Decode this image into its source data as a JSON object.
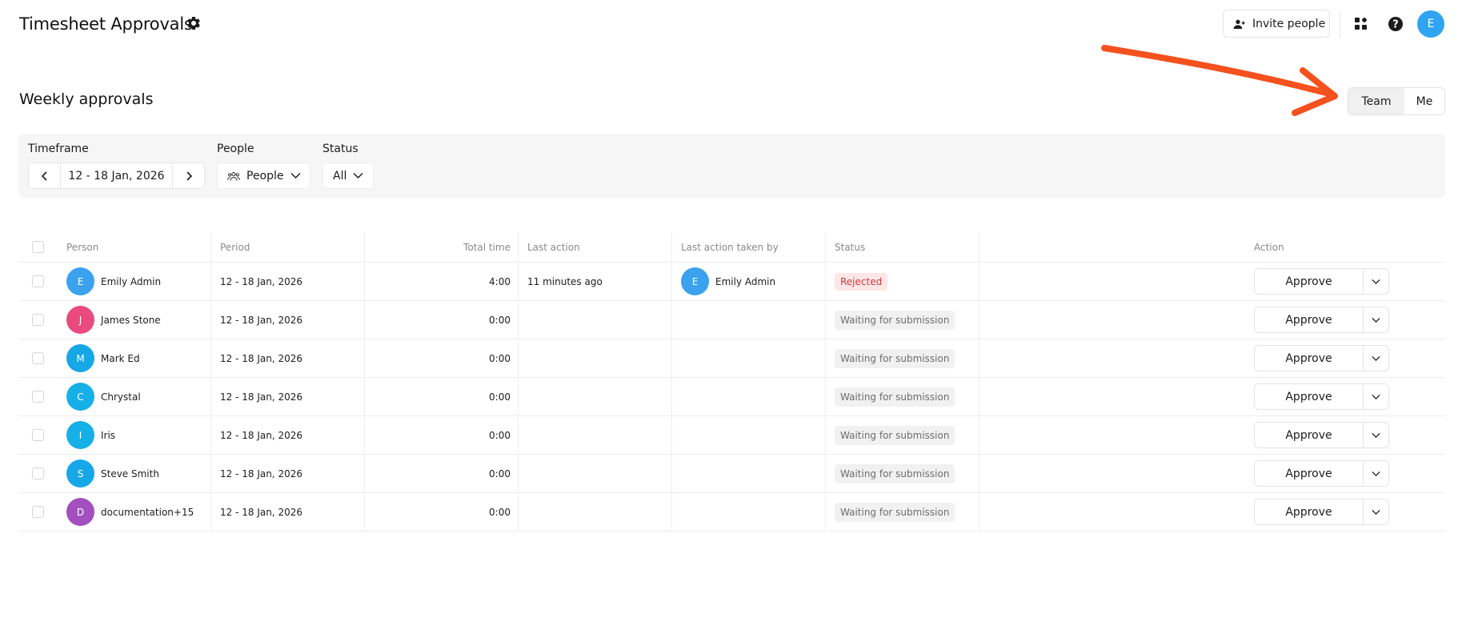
{
  "header": {
    "title": "Timesheet Approvals",
    "invite_label": "Invite people",
    "user_initial": "E"
  },
  "section": {
    "title": "Weekly approvals",
    "toggle": {
      "team_label": "Team",
      "me_label": "Me",
      "selected": "Team"
    }
  },
  "filters": {
    "timeframe_label": "Timeframe",
    "timeframe_value": "12 - 18 Jan, 2026",
    "people_label": "People",
    "people_value": "People",
    "status_label": "Status",
    "status_value": "All"
  },
  "table": {
    "columns": {
      "person": "Person",
      "period": "Period",
      "total_time": "Total time",
      "last_action": "Last action",
      "last_action_by": "Last action taken by",
      "status": "Status",
      "action": "Action"
    },
    "approve_label": "Approve",
    "rows": [
      {
        "initial": "E",
        "avatar_color": "#3aa2ee",
        "name": "Emily Admin",
        "period": "12 - 18 Jan, 2026",
        "total": "4:00",
        "last_action": "11 minutes ago",
        "by_initial": "E",
        "by_name": "Emily Admin",
        "status": "Rejected",
        "status_type": "rejected"
      },
      {
        "initial": "J",
        "avatar_color": "#ea4a7d",
        "name": "James Stone",
        "period": "12 - 18 Jan, 2026",
        "total": "0:00",
        "last_action": "",
        "by_initial": "",
        "by_name": "",
        "status": "Waiting for submission",
        "status_type": "waiting"
      },
      {
        "initial": "M",
        "avatar_color": "#15a7e6",
        "name": "Mark Ed",
        "period": "12 - 18 Jan, 2026",
        "total": "0:00",
        "last_action": "",
        "by_initial": "",
        "by_name": "",
        "status": "Waiting for submission",
        "status_type": "waiting"
      },
      {
        "initial": "C",
        "avatar_color": "#15b0e8",
        "name": "Chrystal",
        "period": "12 - 18 Jan, 2026",
        "total": "0:00",
        "last_action": "",
        "by_initial": "",
        "by_name": "",
        "status": "Waiting for submission",
        "status_type": "waiting"
      },
      {
        "initial": "I",
        "avatar_color": "#15b0e8",
        "name": "Iris",
        "period": "12 - 18 Jan, 2026",
        "total": "0:00",
        "last_action": "",
        "by_initial": "",
        "by_name": "",
        "status": "Waiting for submission",
        "status_type": "waiting"
      },
      {
        "initial": "S",
        "avatar_color": "#15a7e6",
        "name": "Steve Smith",
        "period": "12 - 18 Jan, 2026",
        "total": "0:00",
        "last_action": "",
        "by_initial": "",
        "by_name": "",
        "status": "Waiting for submission",
        "status_type": "waiting"
      },
      {
        "initial": "D",
        "avatar_color": "#a24fbf",
        "name": "documentation+15",
        "period": "12 - 18 Jan, 2026",
        "total": "0:00",
        "last_action": "",
        "by_initial": "",
        "by_name": "",
        "status": "Waiting for submission",
        "status_type": "waiting"
      }
    ]
  },
  "colors": {
    "annotation_arrow": "#f4511e",
    "rejected_text": "#d23b3b",
    "rejected_bg": "#fde6e6",
    "avatar_user": "#2ea4f2"
  },
  "icons": {
    "settings": "gear-icon",
    "invite": "add-person-icon",
    "apps": "apps-icon",
    "help": "help-icon",
    "people": "people-icon"
  }
}
